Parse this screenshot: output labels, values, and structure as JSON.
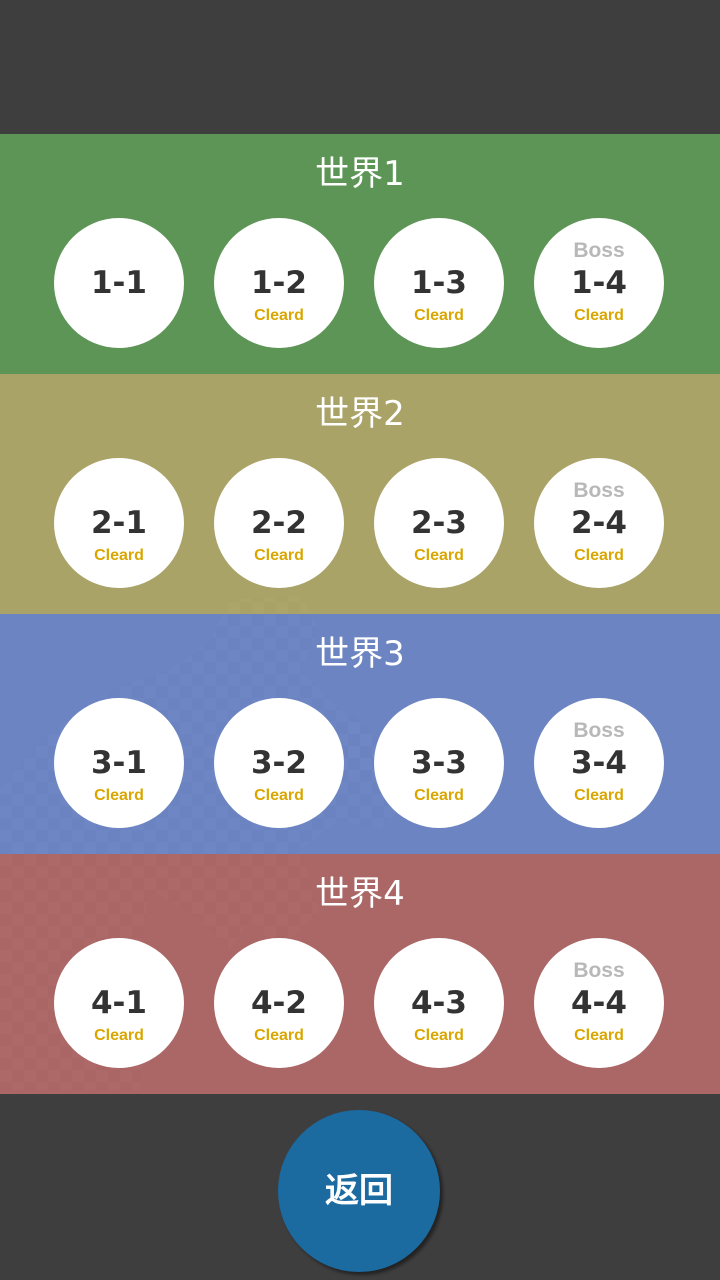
{
  "colors": {
    "background": "#3e3e3e",
    "stage_circle": "#ffffff",
    "stage_number": "#333333",
    "cleared_text": "#d9a700",
    "boss_text": "#b8b8b8",
    "back_button": "#1b6aa0"
  },
  "worlds": [
    {
      "title": "世界1",
      "color": "#5f9f58",
      "stages": [
        {
          "label": "1-1",
          "boss": "",
          "status": ""
        },
        {
          "label": "1-2",
          "boss": "",
          "status": "Cleard"
        },
        {
          "label": "1-3",
          "boss": "",
          "status": "Cleard"
        },
        {
          "label": "1-4",
          "boss": "Boss",
          "status": "Cleard"
        }
      ]
    },
    {
      "title": "世界2",
      "color": "#b6ae6c",
      "stages": [
        {
          "label": "2-1",
          "boss": "",
          "status": "Cleard"
        },
        {
          "label": "2-2",
          "boss": "",
          "status": "Cleard"
        },
        {
          "label": "2-3",
          "boss": "",
          "status": "Cleard"
        },
        {
          "label": "2-4",
          "boss": "Boss",
          "status": "Cleard"
        }
      ]
    },
    {
      "title": "世界3",
      "color": "#718dd0",
      "stages": [
        {
          "label": "3-1",
          "boss": "",
          "status": "Cleard"
        },
        {
          "label": "3-2",
          "boss": "",
          "status": "Cleard"
        },
        {
          "label": "3-3",
          "boss": "",
          "status": "Cleard"
        },
        {
          "label": "3-4",
          "boss": "Boss",
          "status": "Cleard"
        }
      ]
    },
    {
      "title": "世界4",
      "color": "#b76a6a",
      "stages": [
        {
          "label": "4-1",
          "boss": "",
          "status": "Cleard"
        },
        {
          "label": "4-2",
          "boss": "",
          "status": "Cleard"
        },
        {
          "label": "4-3",
          "boss": "",
          "status": "Cleard"
        },
        {
          "label": "4-4",
          "boss": "Boss",
          "status": "Cleard"
        }
      ]
    }
  ],
  "back_button": {
    "label": "返回",
    "icon": "back-circle"
  },
  "background_art": {
    "icon": "checkered-figure-silhouette"
  }
}
